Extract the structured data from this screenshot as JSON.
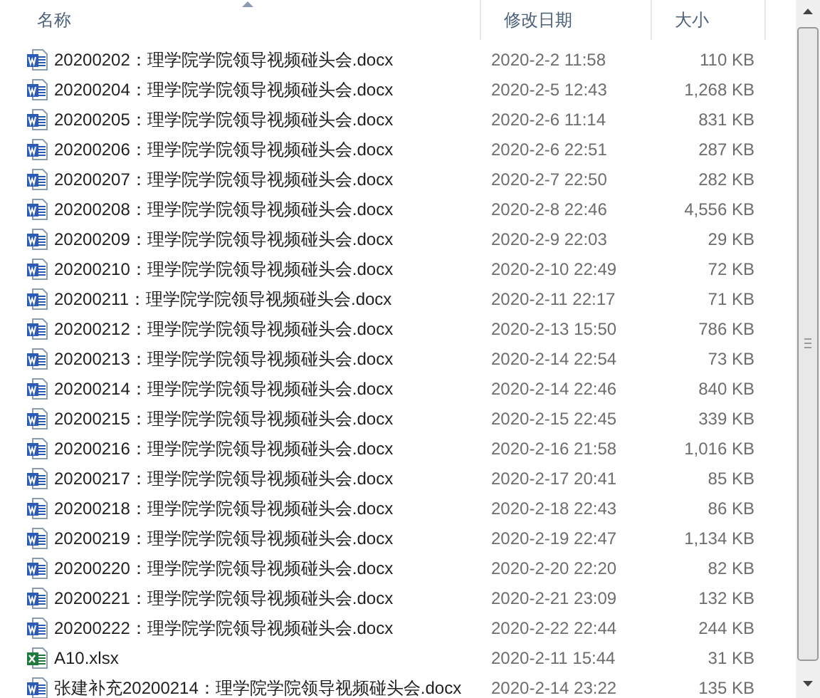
{
  "columns": [
    {
      "label": "名称",
      "sorted": true
    },
    {
      "label": "修改日期",
      "sorted": false
    },
    {
      "label": "大小",
      "sorted": false
    }
  ],
  "files": [
    {
      "kind": "word",
      "name": "20200202：理学院学院领导视频碰头会.docx",
      "date": "2020-2-2 11:58",
      "size": "110 KB"
    },
    {
      "kind": "word",
      "name": "20200204：理学院学院领导视频碰头会.docx",
      "date": "2020-2-5 12:43",
      "size": "1,268 KB"
    },
    {
      "kind": "word",
      "name": "20200205：理学院学院领导视频碰头会.docx",
      "date": "2020-2-6 11:14",
      "size": "831 KB"
    },
    {
      "kind": "word",
      "name": "20200206：理学院学院领导视频碰头会.docx",
      "date": "2020-2-6 22:51",
      "size": "287 KB"
    },
    {
      "kind": "word",
      "name": "20200207：理学院学院领导视频碰头会.docx",
      "date": "2020-2-7 22:50",
      "size": "282 KB"
    },
    {
      "kind": "word",
      "name": "20200208：理学院学院领导视频碰头会.docx",
      "date": "2020-2-8 22:46",
      "size": "4,556 KB"
    },
    {
      "kind": "word",
      "name": "20200209：理学院学院领导视频碰头会.docx",
      "date": "2020-2-9 22:03",
      "size": "29 KB"
    },
    {
      "kind": "word",
      "name": "20200210：理学院学院领导视频碰头会.docx",
      "date": "2020-2-10 22:49",
      "size": "72 KB"
    },
    {
      "kind": "word",
      "name": "20200211：理学院学院领导视频碰头会.docx",
      "date": "2020-2-11 22:17",
      "size": "71 KB"
    },
    {
      "kind": "word",
      "name": "20200212：理学院学院领导视频碰头会.docx",
      "date": "2020-2-13 15:50",
      "size": "786 KB"
    },
    {
      "kind": "word",
      "name": "20200213：理学院学院领导视频碰头会.docx",
      "date": "2020-2-14 22:54",
      "size": "73 KB"
    },
    {
      "kind": "word",
      "name": "20200214：理学院学院领导视频碰头会.docx",
      "date": "2020-2-14 22:46",
      "size": "840 KB"
    },
    {
      "kind": "word",
      "name": "20200215：理学院学院领导视频碰头会.docx",
      "date": "2020-2-15 22:45",
      "size": "339 KB"
    },
    {
      "kind": "word",
      "name": "20200216：理学院学院领导视频碰头会.docx",
      "date": "2020-2-16 21:58",
      "size": "1,016 KB"
    },
    {
      "kind": "word",
      "name": "20200217：理学院学院领导视频碰头会.docx",
      "date": "2020-2-17 20:41",
      "size": "85 KB"
    },
    {
      "kind": "word",
      "name": "20200218：理学院学院领导视频碰头会.docx",
      "date": "2020-2-18 22:43",
      "size": "86 KB"
    },
    {
      "kind": "word",
      "name": "20200219：理学院学院领导视频碰头会.docx",
      "date": "2020-2-19 22:47",
      "size": "1,134 KB"
    },
    {
      "kind": "word",
      "name": "20200220：理学院学院领导视频碰头会.docx",
      "date": "2020-2-20 22:20",
      "size": "82 KB"
    },
    {
      "kind": "word",
      "name": "20200221：理学院学院领导视频碰头会.docx",
      "date": "2020-2-21 23:09",
      "size": "132 KB"
    },
    {
      "kind": "word",
      "name": "20200222：理学院学院领导视频碰头会.docx",
      "date": "2020-2-22 22:44",
      "size": "244 KB"
    },
    {
      "kind": "excel",
      "name": "A10.xlsx",
      "date": "2020-2-11 15:44",
      "size": "31 KB"
    },
    {
      "kind": "word",
      "name": "张建补充20200214：理学院学院领导视频碰头会.docx",
      "date": "2020-2-14 23:22",
      "size": "135 KB"
    }
  ]
}
